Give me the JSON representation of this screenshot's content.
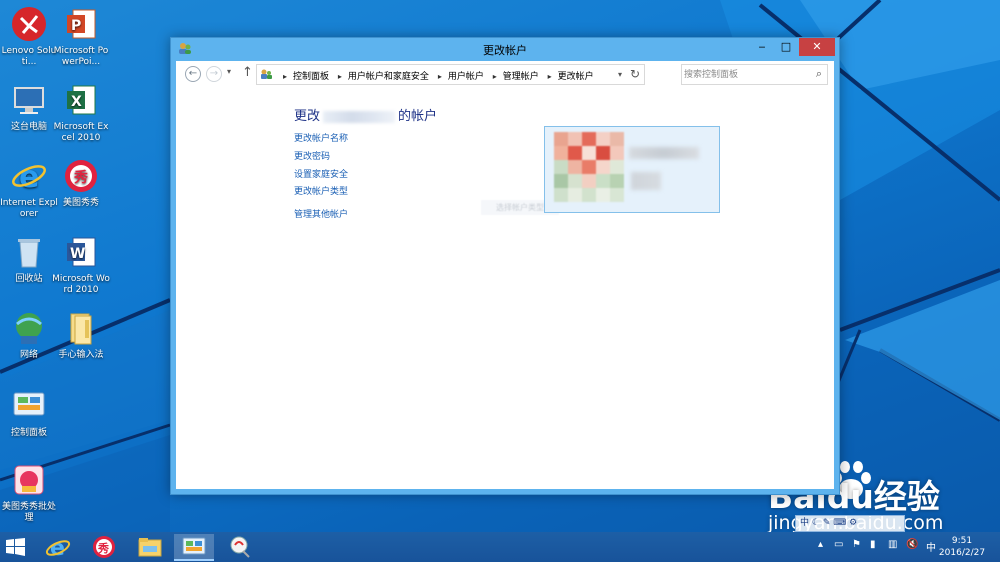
{
  "desktop": {
    "icons": [
      {
        "label": "Lenovo Soluti...",
        "icon": "lenovo-solution-icon"
      },
      {
        "label": "Microsoft PowerPoi...",
        "icon": "powerpoint-icon"
      },
      {
        "label": "这台电脑",
        "icon": "this-pc-icon"
      },
      {
        "label": "Microsoft Excel 2010",
        "icon": "excel-icon"
      },
      {
        "label": "Internet Explorer",
        "icon": "internet-explorer-icon"
      },
      {
        "label": "美图秀秀",
        "icon": "meitu-xiuxiu-icon"
      },
      {
        "label": "回收站",
        "icon": "recycle-bin-icon"
      },
      {
        "label": "Microsoft Word 2010",
        "icon": "word-icon"
      },
      {
        "label": "网络",
        "icon": "network-icon"
      },
      {
        "label": "手心输入法",
        "icon": "folder-icon"
      },
      {
        "label": "控制面板",
        "icon": "control-panel-icon"
      },
      {
        "label": "美图秀秀批处理",
        "icon": "meitu-batch-icon"
      }
    ]
  },
  "window": {
    "title": "更改帐户",
    "buttons": {
      "minimize": "‒",
      "maximize": "□",
      "close": "✕"
    },
    "address": {
      "crumbs": [
        "控制面板",
        "用户帐户和家庭安全",
        "用户帐户",
        "管理帐户",
        "更改帐户"
      ],
      "search_placeholder": "搜索控制面板"
    },
    "content": {
      "heading_prefix": "更改",
      "heading_suffix": "的帐户",
      "links": [
        "更改帐户名称",
        "更改密码",
        "设置家庭安全",
        "更改帐户类型",
        "管理其他帐户"
      ],
      "ghost_text": "选择帐户类型"
    }
  },
  "taskbar": {
    "items": [
      {
        "name": "internet-explorer",
        "active": false
      },
      {
        "name": "meitu-xiuxiu",
        "active": false
      },
      {
        "name": "file-explorer",
        "active": false
      },
      {
        "name": "control-panel",
        "active": true
      },
      {
        "name": "ime-settings",
        "active": false
      }
    ],
    "tray": {
      "ime_label": "中"
    },
    "clock": {
      "time": "9:51",
      "date": "2016/2/27"
    }
  },
  "watermark": {
    "brand": "Baidu经验",
    "url": "jingyan.baidu.com"
  },
  "ime_bar": {
    "label": "中"
  },
  "colors": {
    "link": "#1a5fb4",
    "heading": "#1e3287",
    "window_frame": "#5db3ee",
    "close_button": "#c74142",
    "desktop": "#0f78cf",
    "taskbar": "#1b5aa2"
  }
}
